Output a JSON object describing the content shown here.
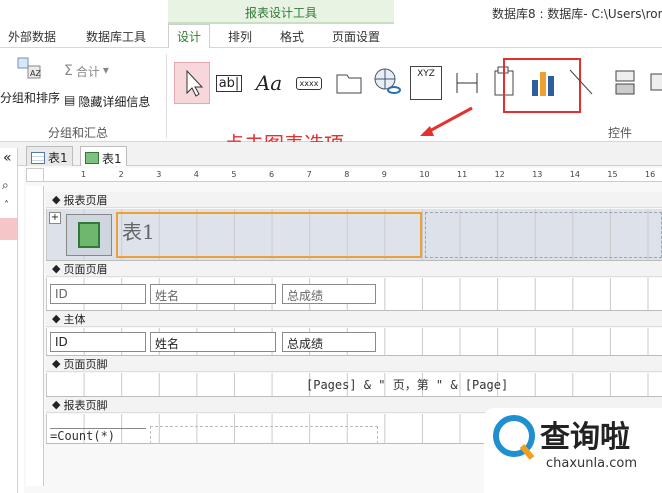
{
  "context_tab_title": "报表设计工具",
  "app_title": "数据库8 : 数据库- C:\\Users\\ron",
  "tabs": [
    "外部数据",
    "数据库工具",
    "设计",
    "排列",
    "格式",
    "页面设置"
  ],
  "ribbon": {
    "group_grouping": {
      "label": "分组和汇总",
      "sort_label": "分组和排序",
      "totals_label": "合计",
      "hide_details_label": "隐藏详细信息"
    },
    "controls_group_label": "控件",
    "controls": [
      {
        "name": "select",
        "text": ""
      },
      {
        "name": "textbox",
        "text": "ab|"
      },
      {
        "name": "label",
        "text": "Aa"
      },
      {
        "name": "button",
        "text": "xxxx"
      },
      {
        "name": "tab-control",
        "text": ""
      },
      {
        "name": "hyperlink",
        "text": ""
      },
      {
        "name": "web-browser",
        "text": "XYZ"
      },
      {
        "name": "navigation",
        "text": ""
      },
      {
        "name": "option-group",
        "text": ""
      },
      {
        "name": "chart",
        "text": ""
      },
      {
        "name": "line",
        "text": ""
      },
      {
        "name": "toggle",
        "text": ""
      },
      {
        "name": "more",
        "text": ""
      }
    ]
  },
  "annotation": "点击图表选项",
  "doc_tabs": [
    "表1",
    "表1"
  ],
  "ruler_numbers": [
    "1",
    "2",
    "3",
    "4",
    "5",
    "6",
    "7",
    "8",
    "9",
    "10",
    "11",
    "12",
    "13",
    "14",
    "15",
    "16"
  ],
  "sections": {
    "report_header": "报表页眉",
    "page_header": "页面页眉",
    "detail": "主体",
    "page_footer": "页面页脚",
    "report_footer": "报表页脚"
  },
  "report_title": "表1",
  "page_header_fields": [
    "ID",
    "姓名",
    "总成绩"
  ],
  "detail_fields": [
    "ID",
    "姓名",
    "总成绩"
  ],
  "page_footer_expr": "[Pages] & \" 页，第 \" & [Page]",
  "report_footer_expr": "=Count(*)",
  "watermark": {
    "brand": "查询啦",
    "url": "chaxunla.com"
  }
}
